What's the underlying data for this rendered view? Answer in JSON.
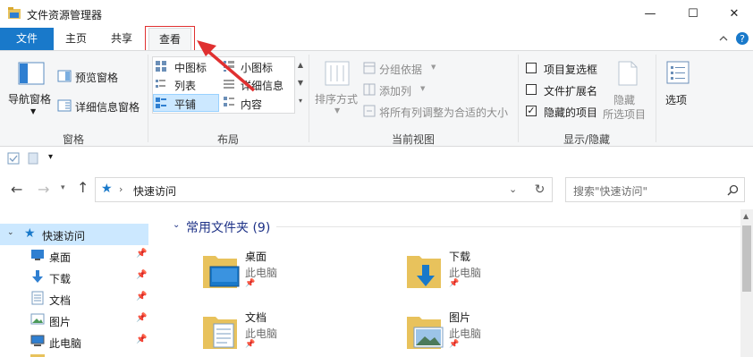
{
  "window": {
    "title": "文件资源管理器",
    "min": "—",
    "max": "☐",
    "close": "✕"
  },
  "tabs": {
    "file": "文件",
    "home": "主页",
    "share": "共享",
    "view": "查看"
  },
  "ribbon": {
    "panes": {
      "nav_pane": "导航窗格",
      "preview_pane": "预览窗格",
      "details_pane": "详细信息窗格",
      "group": "窗格"
    },
    "layout": {
      "medium_icons": "中图标",
      "small_icons": "小图标",
      "list": "列表",
      "details": "详细信息",
      "tiles": "平铺",
      "content": "内容",
      "group": "布局"
    },
    "current_view": {
      "sort_by": "排序方式",
      "group_by": "分组依据",
      "add_column": "添加列",
      "size_all_columns": "将所有列调整为合适的大小",
      "group": "当前视图"
    },
    "show_hide": {
      "item_checkboxes": "项目复选框",
      "file_extensions": "文件扩展名",
      "hidden_items": "隐藏的项目",
      "item_checkboxes_checked": false,
      "file_extensions_checked": false,
      "hidden_items_checked": true,
      "hide_selected": "隐藏",
      "hide_selected_sub": "所选项目",
      "group": "显示/隐藏"
    },
    "options": "选项"
  },
  "address": {
    "location": "快速访问",
    "search_placeholder": "搜索\"快速访问\""
  },
  "nav": {
    "items": [
      {
        "label": "快速访问",
        "icon": "star-icon"
      },
      {
        "label": "桌面",
        "icon": "desktop-icon"
      },
      {
        "label": "下载",
        "icon": "download-icon"
      },
      {
        "label": "文档",
        "icon": "document-icon"
      },
      {
        "label": "图片",
        "icon": "picture-icon"
      },
      {
        "label": "此电脑",
        "icon": "pc-icon"
      }
    ]
  },
  "content": {
    "section_title": "常用文件夹 (9)",
    "folders": [
      {
        "name": "桌面",
        "location": "此电脑"
      },
      {
        "name": "下载",
        "location": "此电脑"
      },
      {
        "name": "文档",
        "location": "此电脑"
      },
      {
        "name": "图片",
        "location": "此电脑"
      }
    ]
  },
  "colors": {
    "accent": "#1979ca",
    "selection": "#cce8ff",
    "folder": "#e8c25c",
    "annotation_red": "#e03030"
  }
}
